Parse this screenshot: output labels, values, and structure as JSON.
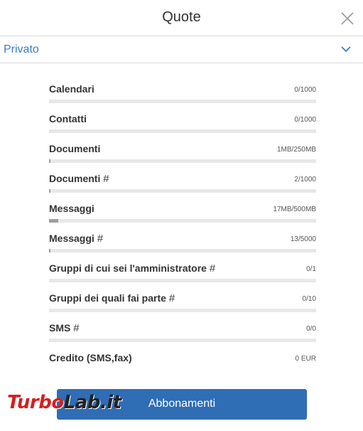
{
  "dialog": {
    "title": "Quote",
    "close_icon": "close-icon"
  },
  "account": {
    "selected": "Privato",
    "chevron_icon": "chevron-down-icon"
  },
  "quotas": [
    {
      "label": "Calendari",
      "hash": "",
      "value": "0/1000",
      "fraction": 0
    },
    {
      "label": "Contatti",
      "hash": "",
      "value": "0/1000",
      "fraction": 0
    },
    {
      "label": "Documenti",
      "hash": "",
      "value": "1MB/250MB",
      "fraction": 0.004
    },
    {
      "label": "Documenti",
      "hash": "#",
      "value": "2/1000",
      "fraction": 0.002
    },
    {
      "label": "Messaggi",
      "hash": "",
      "value": "17MB/500MB",
      "fraction": 0.034
    },
    {
      "label": "Messaggi",
      "hash": "#",
      "value": "13/5000",
      "fraction": 0.0026
    },
    {
      "label": "Gruppi di cui sei l'amministratore",
      "hash": "#",
      "value": "0/1",
      "fraction": 0
    },
    {
      "label": "Gruppi dei quali fai parte",
      "hash": "#",
      "value": "0/10",
      "fraction": 0
    },
    {
      "label": "SMS",
      "hash": "#",
      "value": "0/0",
      "fraction": 0
    },
    {
      "label": "Credito (SMS,fax)",
      "hash": "",
      "value": "0 EUR",
      "fraction": null
    }
  ],
  "actions": {
    "subscriptions_label": "Abbonamenti"
  },
  "watermark": {
    "part1": "Turbo",
    "part2": "Lab.it"
  },
  "colors": {
    "accent": "#2f6db5",
    "link": "#3a7bc8",
    "bar_fill": "#9e9e9e",
    "bar_track": "#e8e8e8"
  }
}
